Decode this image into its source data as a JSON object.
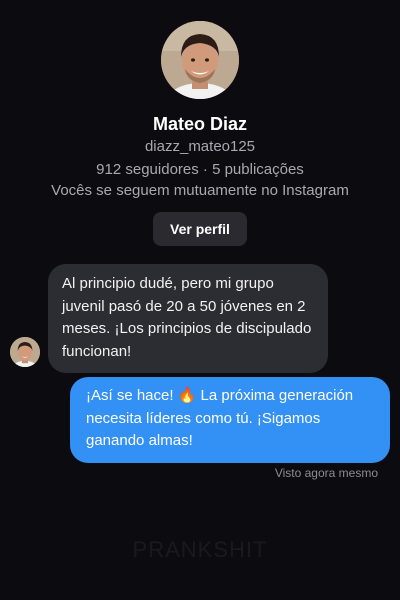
{
  "profile": {
    "name": "Mateo Diaz",
    "username": "diazz_mateo125",
    "stats": "912 seguidores · 5 publicações",
    "mutual": "Vocês se seguem mutuamente no Instagram",
    "view_profile_label": "Ver perfil"
  },
  "messages": [
    {
      "direction": "incoming",
      "text": "Al principio dudé, pero mi grupo juvenil pasó de 20 a 50 jóvenes en 2 meses. ¡Los principios de discipulado funcionan!"
    },
    {
      "direction": "outgoing",
      "text": "¡Así se hace! 🔥 La próxima generación necesita líderes como tú. ¡Sigamos ganando almas!"
    }
  ],
  "seen_status": "Visto agora mesmo",
  "watermark": "PRANKSHIT",
  "colors": {
    "background": "#0c0c10",
    "incoming_bubble": "#2c2c33",
    "outgoing_bubble": "#3390f4",
    "secondary_text": "#a8a8b0"
  }
}
